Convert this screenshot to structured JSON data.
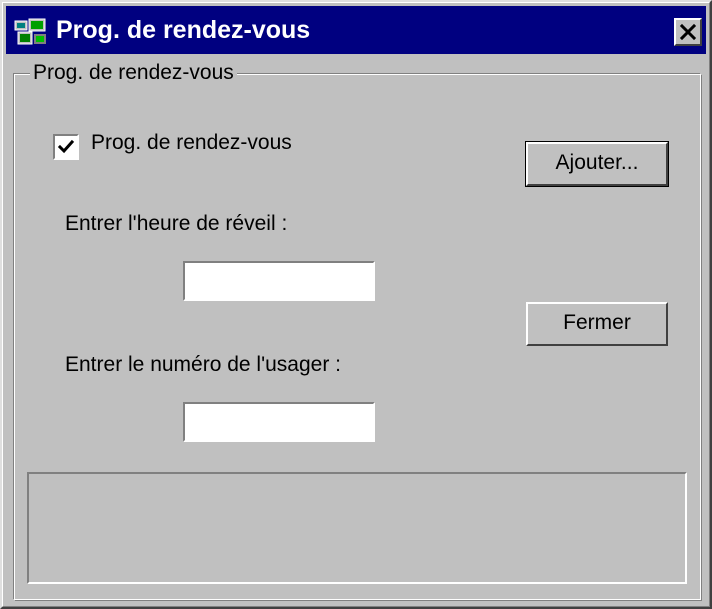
{
  "window": {
    "title": "Prog. de rendez-vous",
    "icon": "scheduler-app-icon",
    "close_symbol": "close-icon",
    "titlebar_color": "#000080"
  },
  "group": {
    "legend": "Prog. de rendez-vous"
  },
  "checkbox": {
    "label": "Prog. de rendez-vous",
    "checked": true
  },
  "fields": {
    "heure_label": "Entrer l'heure de réveil :",
    "heure_value": "",
    "usager_label": "Entrer le numéro de l'usager :",
    "usager_value": ""
  },
  "buttons": {
    "ajouter": "Ajouter...",
    "fermer": "Fermer"
  }
}
